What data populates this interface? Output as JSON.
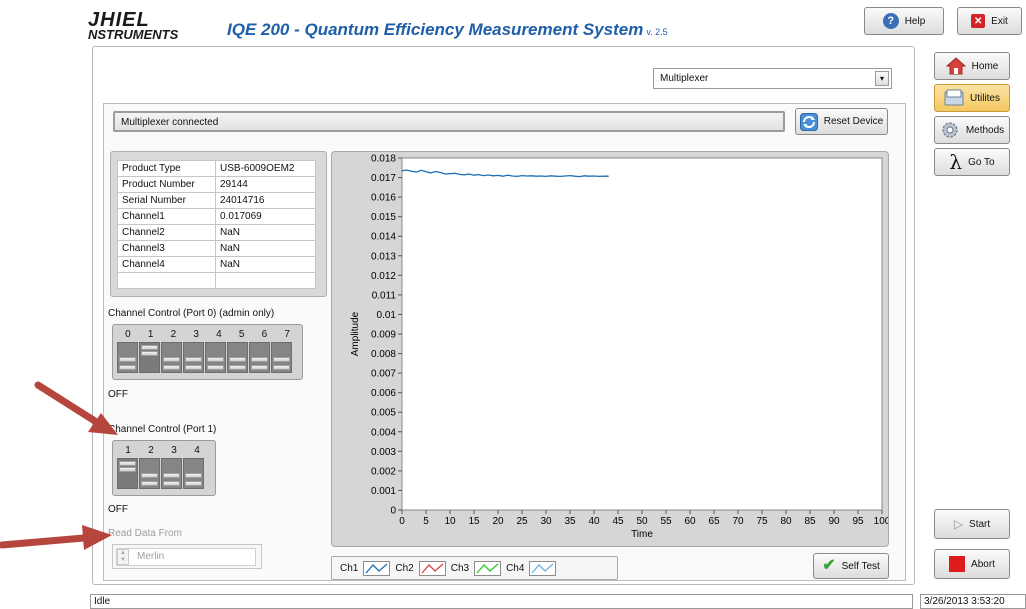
{
  "header": {
    "logo_line1": "JHIEL",
    "logo_line2": "NSTRUMENTS",
    "title": "IQE 200 - Quantum Efficiency Measurement System",
    "version": "v. 2.5",
    "help_label": "Help",
    "exit_label": "Exit"
  },
  "sidebar": {
    "home": "Home",
    "utilities": "Utilites",
    "methods": "Methods",
    "goto": "Go To",
    "start": "Start",
    "abort": "Abort"
  },
  "device_select": {
    "value": "Multiplexer"
  },
  "status_message": "Multiplexer connected",
  "reset_button": "Reset Device",
  "info_table": [
    [
      "Product Type",
      "USB-6009OEM2"
    ],
    [
      "Product Number",
      "29144"
    ],
    [
      "Serial Number",
      "24014716"
    ],
    [
      "Channel1",
      "0.017069"
    ],
    [
      "Channel2",
      "NaN"
    ],
    [
      "Channel3",
      "NaN"
    ],
    [
      "Channel4",
      "NaN"
    ]
  ],
  "port0": {
    "label": "Channel Control (Port 0) (admin only)",
    "numbers": [
      "0",
      "1",
      "2",
      "3",
      "4",
      "5",
      "6",
      "7"
    ],
    "state_label": "OFF"
  },
  "port1": {
    "label": "Channel Control (Port 1)",
    "numbers": [
      "1",
      "2",
      "3",
      "4"
    ],
    "state_label": "OFF"
  },
  "read_data": {
    "label": "Read Data From",
    "value": "Merlin"
  },
  "legend": {
    "items": [
      {
        "label": "Ch1",
        "color": "#1f6fb5"
      },
      {
        "label": "Ch2",
        "color": "#e04040"
      },
      {
        "label": "Ch3",
        "color": "#2ec82e"
      },
      {
        "label": "Ch4",
        "color": "#6ab4e8"
      }
    ]
  },
  "self_test_button": "Self Test",
  "statusbar": {
    "state": "Idle",
    "timestamp": "3/26/2013 3:53:20"
  },
  "chart_data": {
    "type": "line",
    "xlabel": "Time",
    "ylabel": "Amplitude",
    "xlim": [
      0,
      100
    ],
    "ylim": [
      0,
      0.018
    ],
    "x_ticks": [
      "0",
      "5",
      "10",
      "15",
      "20",
      "25",
      "30",
      "35",
      "40",
      "45",
      "50",
      "55",
      "60",
      "65",
      "70",
      "75",
      "80",
      "85",
      "90",
      "95",
      "100"
    ],
    "y_ticks": [
      "0",
      "0.001",
      "0.002",
      "0.003",
      "0.004",
      "0.005",
      "0.006",
      "0.007",
      "0.008",
      "0.009",
      "0.01",
      "0.011",
      "0.012",
      "0.013",
      "0.014",
      "0.015",
      "0.016",
      "0.017",
      "0.018"
    ],
    "grid": false,
    "series": [
      {
        "name": "Ch1",
        "color": "#1f6fb5",
        "x": [
          0,
          1,
          2,
          3,
          4,
          5,
          6,
          7,
          8,
          9,
          10,
          11,
          12,
          13,
          14,
          15,
          16,
          17,
          18,
          19,
          20,
          21,
          22,
          23,
          24,
          25,
          26,
          27,
          28,
          29,
          30,
          31,
          32,
          33,
          34,
          35,
          36,
          37,
          38,
          39,
          40,
          41,
          42,
          43
        ],
        "y": [
          0.01735,
          0.01738,
          0.01732,
          0.01728,
          0.01737,
          0.0173,
          0.01724,
          0.01731,
          0.01726,
          0.01718,
          0.0172,
          0.01722,
          0.01716,
          0.01714,
          0.01718,
          0.01712,
          0.01715,
          0.0171,
          0.01713,
          0.01709,
          0.01711,
          0.01707,
          0.01712,
          0.01708,
          0.01706,
          0.0171,
          0.01708,
          0.01709,
          0.01707,
          0.01708,
          0.01706,
          0.01709,
          0.01707,
          0.01706,
          0.01708,
          0.0171,
          0.01707,
          0.01705,
          0.01709,
          0.01707,
          0.01708,
          0.01706,
          0.01707,
          0.01707
        ]
      }
    ]
  }
}
